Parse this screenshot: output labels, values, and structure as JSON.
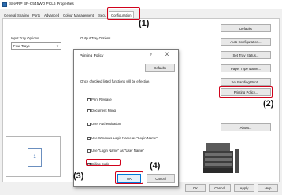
{
  "window": {
    "title": "SHARP BP-C545WD PCL6 Properties"
  },
  "tabs": [
    "General",
    "Sharing",
    "Ports",
    "Advanced",
    "Colour Management",
    "Secu",
    "Configuration"
  ],
  "main": {
    "defaults_label": "Defaults",
    "input_tray_label": "Input Tray Options",
    "input_tray_value": "Four Trays",
    "output_tray_label": "Output Tray Options",
    "side_buttons": [
      "Auto Configuration...",
      "Set Tray Status...",
      "Paper Type Name...",
      "Set Banding Print...",
      "Printing Policy..."
    ],
    "about_label": "About..."
  },
  "preview": {
    "page_number": "1"
  },
  "bottom_buttons": {
    "ok": "OK",
    "cancel": "Cancel",
    "apply": "Apply",
    "help": "Help"
  },
  "dialog": {
    "title": "Printing Policy",
    "help": "?",
    "close": "X",
    "defaults_label": "Defaults",
    "description": "Once checked listed functions will be effective.",
    "items": [
      "Print Release",
      "Document Filing",
      "User Authentication",
      "Use Windows Login Name as \"Login Name\"",
      "Use \"Login Name\" as \"User Name\"",
      "Billing Code"
    ],
    "ok_label": "OK",
    "cancel_label": "Cancel"
  },
  "callouts": [
    "(1)",
    "(2)",
    "(3)",
    "(4)"
  ],
  "colors": {
    "accent": "#d0021b"
  }
}
